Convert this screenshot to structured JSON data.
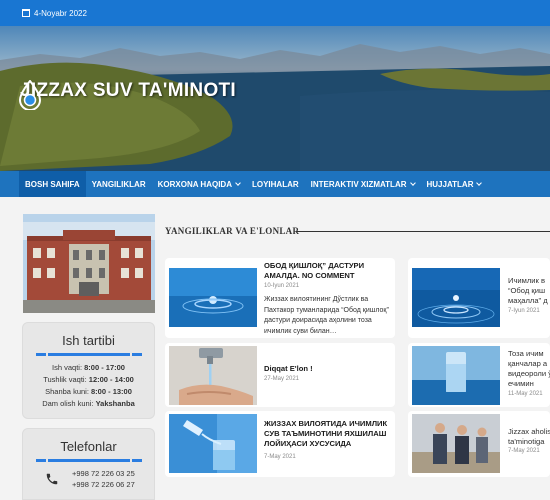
{
  "topbar": {
    "date": "4-Noyabr 2022",
    "icon": "calendar-icon"
  },
  "site": {
    "title": "JIZZAX SUV TA'MINOTI",
    "logo_icon": "water-drop-logo"
  },
  "nav": {
    "items": [
      {
        "label": "BOSH SAHIFA",
        "active": true
      },
      {
        "label": "YANGILIKLAR"
      },
      {
        "label": "KORXONA HAQIDA",
        "dropdown": true
      },
      {
        "label": "LOYIHALAR"
      },
      {
        "label": "INTERAKTIV XIZMATLAR",
        "dropdown": true
      },
      {
        "label": "HUJJATLAR",
        "dropdown": true
      }
    ]
  },
  "schedule": {
    "title": "Ish tartibi",
    "rows": [
      {
        "label": "Ish vaqti:",
        "value": "8:00 - 17:00"
      },
      {
        "label": "Tushlik vaqti:",
        "value": "12:00 - 14:00"
      },
      {
        "label": "Shanba kuni:",
        "value": "8:00 - 13:00"
      },
      {
        "label": "Dam olish kuni:",
        "value": "Yakshanba"
      }
    ]
  },
  "phones": {
    "title": "Telefonlar",
    "numbers": [
      "+998 72 226 03 25",
      "+998 72 226 06 27"
    ],
    "icon": "phone-icon"
  },
  "news": {
    "section_title": "YANGILIKLAR VA E'LONLAR",
    "items": [
      {
        "title": "ОБОД ҚИШЛОҚ” ДАСТУРИ АМАЛДА. NO COMMENT",
        "date": "10-Iyun 2021",
        "excerpt": "Жиззах вилоятининг Дўстлик ва Пахтакор туманларида “Обод қишлоқ” дастури доирасида аҳолини тоза ичимлик суви билан…"
      },
      {
        "title": "Ичимлик в “Обод қиш маҳалла” д",
        "date": "7-Iyun 2021"
      },
      {
        "title": "Diqqat E'lon !",
        "date": "27-May 2021"
      },
      {
        "title": "Тоза ичим қанчалар а видеороли ўз ечимин",
        "date": "11-May 2021"
      },
      {
        "title": "ЖИЗЗАХ ВИЛОЯТИДА ИЧИМЛИК СУВ ТАЪМИНОТИНИ ЯХШИЛАШ ЛОЙИҲАСИ ХУСУСИДА",
        "date": "7-May 2021"
      },
      {
        "title": "Jizzax aholis ta'minotiga",
        "date": "7-May 2021"
      }
    ]
  },
  "colors": {
    "topbar": "#1976d2",
    "nav": "#1e73be",
    "nav_active": "#0f5ea8",
    "accent": "#2a7de1"
  }
}
